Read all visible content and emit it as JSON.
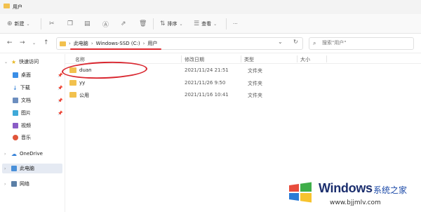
{
  "window": {
    "title": "用户"
  },
  "toolbar": {
    "new_label": "新建",
    "sort_label": "排序",
    "view_label": "查看",
    "more_label": "···"
  },
  "address": {
    "crumbs": [
      "此电脑",
      "Windows-SSD (C:)",
      "用户"
    ]
  },
  "search": {
    "placeholder": "搜索\"用户\""
  },
  "sidebar": {
    "items": [
      {
        "label": "快速访问",
        "icon": "star-icon"
      },
      {
        "label": "桌面",
        "icon": "desktop-icon"
      },
      {
        "label": "下载",
        "icon": "download-icon"
      },
      {
        "label": "文档",
        "icon": "document-icon"
      },
      {
        "label": "图片",
        "icon": "picture-icon"
      },
      {
        "label": "视频",
        "icon": "video-icon"
      },
      {
        "label": "音乐",
        "icon": "music-icon"
      },
      {
        "label": "OneDrive",
        "icon": "cloud-icon"
      },
      {
        "label": "此电脑",
        "icon": "computer-icon"
      },
      {
        "label": "网络",
        "icon": "network-icon"
      }
    ]
  },
  "columns": {
    "name": "名称",
    "modified": "修改日期",
    "type": "类型",
    "size": "大小"
  },
  "files": [
    {
      "name": "duan",
      "modified": "2021/11/24 21:51",
      "type": "文件夹"
    },
    {
      "name": "yy",
      "modified": "2021/11/26 9:50",
      "type": "文件夹"
    },
    {
      "name": "公用",
      "modified": "2021/11/16 10:41",
      "type": "文件夹"
    }
  ],
  "watermark": {
    "title": "Windows",
    "subtitle": "系统之家",
    "url": "www.bjjmlv.com"
  },
  "colors": {
    "folder": "#f2c14e",
    "annotation_red": "#e0282f",
    "accent": "#0067c0"
  }
}
